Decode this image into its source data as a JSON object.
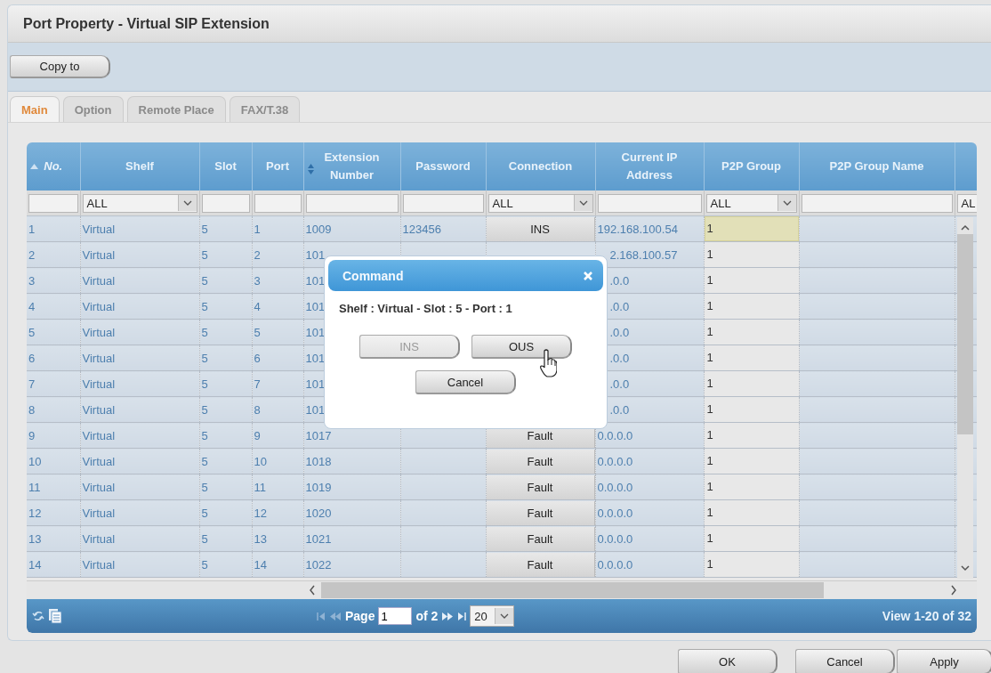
{
  "window": {
    "title": "Port Property - Virtual SIP Extension"
  },
  "toolbar": {
    "buttons": [
      "Copy to"
    ]
  },
  "tabs": [
    {
      "label": "Main",
      "selected": true
    },
    {
      "label": "Option",
      "selected": false
    },
    {
      "label": "Remote Place",
      "selected": false
    },
    {
      "label": "FAX/T.38",
      "selected": false
    }
  ],
  "table": {
    "columns": [
      {
        "label": "No.",
        "sorted": true,
        "filter": {
          "kind": "text"
        }
      },
      {
        "label": "Shelf",
        "filter": {
          "kind": "select",
          "value": "ALL"
        }
      },
      {
        "label": "Slot",
        "filter": {
          "kind": "text"
        }
      },
      {
        "label": "Port",
        "filter": {
          "kind": "text"
        }
      },
      {
        "label": "Extension Number",
        "sortable": true,
        "filter": {
          "kind": "text"
        }
      },
      {
        "label": "Password",
        "filter": {
          "kind": "text"
        }
      },
      {
        "label": "Connection",
        "filter": {
          "kind": "select",
          "value": "ALL"
        }
      },
      {
        "label": "Current IP Address",
        "filter": {
          "kind": "text"
        }
      },
      {
        "label": "P2P Group",
        "filter": {
          "kind": "select",
          "value": "ALL"
        }
      },
      {
        "label": "P2P Group Name",
        "filter": {
          "kind": "text"
        }
      },
      {
        "filter": {
          "kind": "select",
          "value": "AL"
        }
      }
    ],
    "rows": [
      {
        "no": "1",
        "shelf": "Virtual",
        "slot": "5",
        "port": "1",
        "extension": "1009",
        "password": "123456",
        "connection": "INS",
        "ip": "192.168.100.54",
        "p2p_group": "1",
        "selected": true
      },
      {
        "no": "2",
        "shelf": "Virtual",
        "slot": "5",
        "port": "2",
        "extension": "101",
        "ip": "2.168.100.57",
        "p2p_group": "1",
        "selected": false
      },
      {
        "no": "3",
        "shelf": "Virtual",
        "slot": "5",
        "port": "3",
        "extension": "101",
        "ip": ".0.0",
        "p2p_group": "1",
        "selected": false
      },
      {
        "no": "4",
        "shelf": "Virtual",
        "slot": "5",
        "port": "4",
        "extension": "101",
        "ip": ".0.0",
        "p2p_group": "1",
        "selected": false
      },
      {
        "no": "5",
        "shelf": "Virtual",
        "slot": "5",
        "port": "5",
        "extension": "101",
        "ip": ".0.0",
        "p2p_group": "1",
        "selected": false
      },
      {
        "no": "6",
        "shelf": "Virtual",
        "slot": "5",
        "port": "6",
        "extension": "101",
        "ip": ".0.0",
        "p2p_group": "1",
        "selected": false
      },
      {
        "no": "7",
        "shelf": "Virtual",
        "slot": "5",
        "port": "7",
        "extension": "101",
        "ip": ".0.0",
        "p2p_group": "1",
        "selected": false
      },
      {
        "no": "8",
        "shelf": "Virtual",
        "slot": "5",
        "port": "8",
        "extension": "101",
        "ip": ".0.0",
        "p2p_group": "1",
        "selected": false
      },
      {
        "no": "9",
        "shelf": "Virtual",
        "slot": "5",
        "port": "9",
        "extension": "1017",
        "connection": "Fault",
        "ip": "0.0.0.0",
        "p2p_group": "1",
        "selected": false
      },
      {
        "no": "10",
        "shelf": "Virtual",
        "slot": "5",
        "port": "10",
        "extension": "1018",
        "connection": "Fault",
        "ip": "0.0.0.0",
        "p2p_group": "1",
        "selected": false
      },
      {
        "no": "11",
        "shelf": "Virtual",
        "slot": "5",
        "port": "11",
        "extension": "1019",
        "connection": "Fault",
        "ip": "0.0.0.0",
        "p2p_group": "1",
        "selected": false
      },
      {
        "no": "12",
        "shelf": "Virtual",
        "slot": "5",
        "port": "12",
        "extension": "1020",
        "connection": "Fault",
        "ip": "0.0.0.0",
        "p2p_group": "1",
        "selected": false
      },
      {
        "no": "13",
        "shelf": "Virtual",
        "slot": "5",
        "port": "13",
        "extension": "1021",
        "connection": "Fault",
        "ip": "0.0.0.0",
        "p2p_group": "1",
        "selected": false
      },
      {
        "no": "14",
        "shelf": "Virtual",
        "slot": "5",
        "port": "14",
        "extension": "1022",
        "connection": "Fault",
        "ip": "0.0.0.0",
        "p2p_group": "1",
        "selected": false
      }
    ]
  },
  "pager": {
    "page_label": "Page",
    "page": "1",
    "of_label": "of 2",
    "page_size": "20",
    "summary": "View 1-20 of 32"
  },
  "dialog": {
    "title": "Command",
    "message": "Shelf : Virtual - Slot : 5 - Port : 1",
    "buttons": [
      {
        "label": "INS",
        "disabled": true
      },
      {
        "label": "OUS",
        "disabled": false
      },
      {
        "label": "Cancel",
        "disabled": false
      }
    ]
  },
  "footer_buttons": [
    "OK",
    "Cancel",
    "Apply"
  ]
}
